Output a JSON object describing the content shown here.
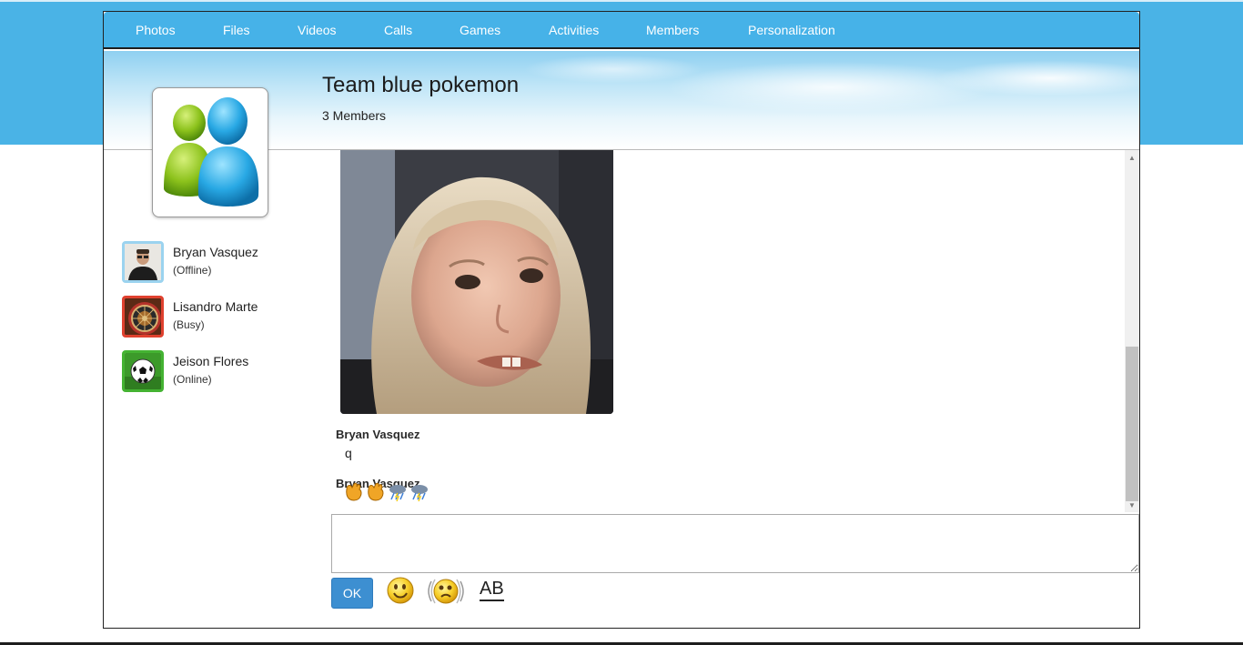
{
  "nav": {
    "items": [
      {
        "label": "Photos"
      },
      {
        "label": "Files"
      },
      {
        "label": "Videos"
      },
      {
        "label": "Calls"
      },
      {
        "label": "Games"
      },
      {
        "label": "Activities"
      },
      {
        "label": "Members"
      },
      {
        "label": "Personalization"
      }
    ]
  },
  "group": {
    "title": "Team blue pokemon",
    "member_count": "3 Members",
    "avatar_icon": "messenger-people-icon"
  },
  "contacts": [
    {
      "name": "Bryan Vasquez",
      "status": "(Offline)",
      "avatar_icon": "man-photo-icon",
      "border_color": "#9bd3ef"
    },
    {
      "name": "Lisandro Marte",
      "status": "(Busy)",
      "avatar_icon": "roulette-icon",
      "border_color": "#e0412f"
    },
    {
      "name": "Jeison Flores",
      "status": "(Online)",
      "avatar_icon": "soccer-ball-icon",
      "border_color": "#44b332"
    }
  ],
  "messages": [
    {
      "sender": "Bryan Vasquez",
      "text": "q"
    },
    {
      "sender": "Bryan Vasquez",
      "text": "",
      "emoticons": [
        "waving-hands-icon",
        "waving-hands-icon",
        "storm-cloud-icon",
        "storm-cloud-icon"
      ]
    }
  ],
  "chat_image": {
    "icon": "child-photo-icon"
  },
  "compose": {
    "placeholder": ""
  },
  "toolbar": {
    "ok_label": "OK",
    "emoticon_icon": "smiley-icon",
    "nudge_icon": "nudge-icon",
    "font_label": "AB"
  },
  "colors": {
    "accent": "#46b2e8",
    "ok_button": "#3d8fd1"
  }
}
